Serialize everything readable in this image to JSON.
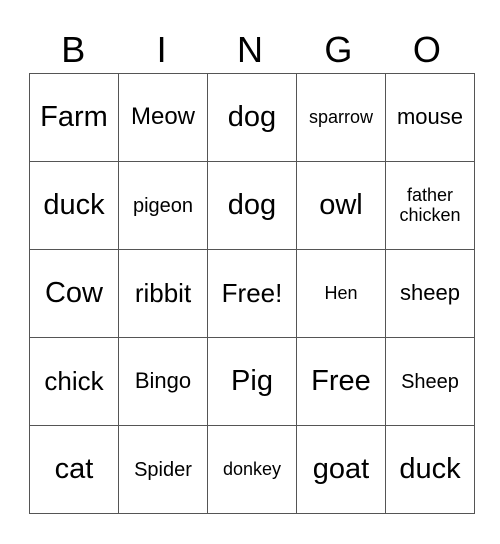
{
  "header": [
    "B",
    "I",
    "N",
    "G",
    "O"
  ],
  "rows": [
    [
      "Farm",
      "Meow",
      "dog",
      "sparrow",
      "mouse"
    ],
    [
      "duck",
      "pigeon",
      "dog",
      "owl",
      "father chicken"
    ],
    [
      "Cow",
      "ribbit",
      "Free!",
      "Hen",
      "sheep"
    ],
    [
      "chick",
      "Bingo",
      "Pig",
      "Free",
      "Sheep"
    ],
    [
      "cat",
      "Spider",
      "donkey",
      "goat",
      "duck"
    ]
  ]
}
